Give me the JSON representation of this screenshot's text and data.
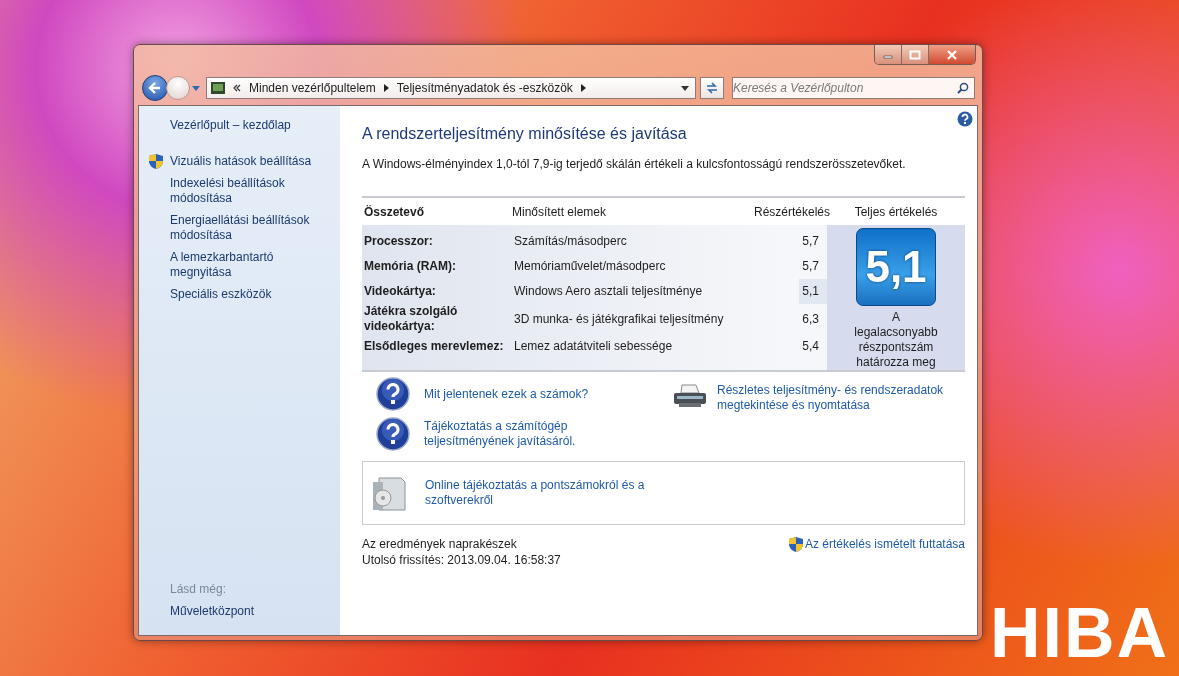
{
  "desktop": {
    "wallpaper_text": "HIBA"
  },
  "address_bar": {
    "breadcrumbs": [
      "Minden vezérlőpultelem",
      "Teljesítményadatok és -eszközök"
    ]
  },
  "search": {
    "placeholder": "Keresés a Vezérlőpulton"
  },
  "sidebar": {
    "items": [
      {
        "text": "Vezérlőpult – kezdőlap",
        "shield": false
      },
      {
        "text": "Vizuális hatások beállítása",
        "shield": true
      },
      {
        "text": "Indexelési beállítások módosítása",
        "shield": false
      },
      {
        "text": "Energiaellátási beállítások módosítása",
        "shield": false
      },
      {
        "text": "A lemezkarbantartó megnyitása",
        "shield": false
      },
      {
        "text": "Speciális eszközök",
        "shield": false
      }
    ],
    "see_also_label": "Lásd még:",
    "see_also": [
      "Műveletközpont"
    ]
  },
  "main": {
    "title": "A rendszerteljesítmény minősítése és javítása",
    "description": "A Windows-élményindex 1,0-tól 7,9-ig terjedő skálán értékeli a kulcsfontosságú rendszerösszetevőket.",
    "table": {
      "columns": [
        "Összetevő",
        "Minősített elemek",
        "Részértékelés",
        "Teljes értékelés"
      ],
      "rows": [
        {
          "component": "Processzor:",
          "rated": "Számítás/másodperc",
          "subscore": "5,7",
          "lowest": false
        },
        {
          "component": "Memória (RAM):",
          "rated": "Memóriaművelet/másodperc",
          "subscore": "5,7",
          "lowest": false
        },
        {
          "component": "Videokártya:",
          "rated": "Windows Aero asztali teljesítménye",
          "subscore": "5,1",
          "lowest": true
        },
        {
          "component": "Játékra szolgáló videokártya:",
          "rated": "3D munka- és játékgrafikai teljesítmény",
          "subscore": "6,3",
          "lowest": false
        },
        {
          "component": "Elsődleges merevlemez:",
          "rated": "Lemez adatátviteli sebessége",
          "subscore": "5,4",
          "lowest": false
        }
      ],
      "base_score": "5,1",
      "base_caption": "A legalacsonyabb részpontszám határozza meg"
    },
    "links_left": [
      "Mit jelentenek ezek a számok?",
      "Tájékoztatás a számítógép teljesítményének javításáról."
    ],
    "link_right": "Részletes teljesítmény- és rendszeradatok megtekintése és nyomtatása",
    "online_link": "Online tájékoztatás a pontszámokról és a szoftverekről",
    "status": "Az eredmények naprakészek",
    "last_update": "Utolsó frissítés: 2013.09.04. 16:58:37",
    "rerun": "Az értékelés ismételt futtatása"
  }
}
